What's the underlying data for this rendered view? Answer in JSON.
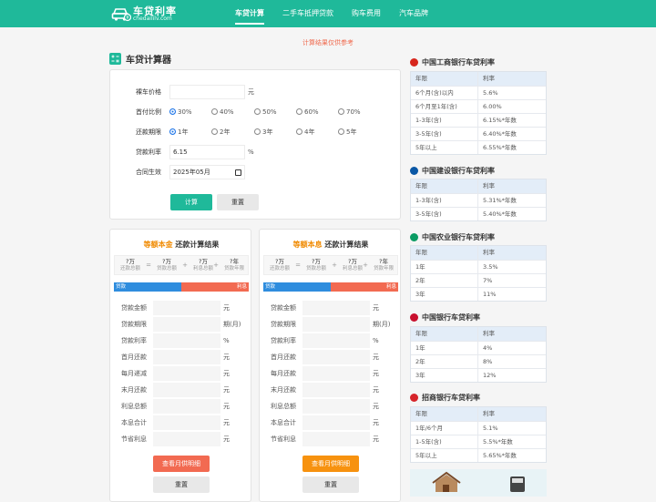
{
  "brand": {
    "title": "车贷利率",
    "subtitle": "chedaililv.com",
    "color": "#1fb99a"
  },
  "nav": [
    {
      "label": "车贷计算",
      "active": true
    },
    {
      "label": "二手车抵押贷款",
      "active": false
    },
    {
      "label": "购车费用",
      "active": false
    },
    {
      "label": "汽车品牌",
      "active": false
    }
  ],
  "notice": "计算结果仅供参考",
  "calculator": {
    "title": "车贷计算器",
    "price": {
      "label": "裸车价格",
      "value": "",
      "unit": "元"
    },
    "down_payment": {
      "label": "首付比例",
      "options": [
        "30%",
        "40%",
        "50%",
        "60%",
        "70%"
      ],
      "selected": "30%"
    },
    "term": {
      "label": "还款期限",
      "options": [
        "1年",
        "2年",
        "3年",
        "4年",
        "5年"
      ],
      "selected": "1年"
    },
    "rate": {
      "label": "贷款利率",
      "value": "6.15",
      "unit": "%"
    },
    "start": {
      "label": "合同生效",
      "value": "2025年05月"
    },
    "calc_button": "计算",
    "reset_button": "重置"
  },
  "results": [
    {
      "title_hl": "等额本金",
      "title_rest": "还款计算结果",
      "formula": [
        {
          "value": "?万",
          "label": "还款总额"
        },
        {
          "value": "?万",
          "label": "贷款总额"
        },
        {
          "value": "?万",
          "label": "利息总额"
        },
        {
          "value": "?年",
          "label": "贷款年限"
        }
      ],
      "ops": [
        "=",
        "+",
        "+"
      ],
      "bar_left": "贷款",
      "bar_right": "利息",
      "rows": [
        {
          "label": "贷款金额",
          "unit": "元"
        },
        {
          "label": "贷款期限",
          "unit": "期(月)"
        },
        {
          "label": "贷款利率",
          "unit": "%"
        },
        {
          "label": "首月还款",
          "unit": "元"
        },
        {
          "label": "每月递减",
          "unit": "元"
        },
        {
          "label": "末月还款",
          "unit": "元"
        },
        {
          "label": "利息总额",
          "unit": "元"
        },
        {
          "label": "本息合计",
          "unit": "元"
        },
        {
          "label": "节省利息",
          "unit": "元"
        }
      ],
      "detail_button": "查看月供明细",
      "detail_color": "#f26a51",
      "reset_button": "重置"
    },
    {
      "title_hl": "等额本息",
      "title_rest": "还款计算结果",
      "formula": [
        {
          "value": "?万",
          "label": "还款总额"
        },
        {
          "value": "?万",
          "label": "贷款总额"
        },
        {
          "value": "?万",
          "label": "利息总额"
        },
        {
          "value": "?年",
          "label": "贷款年限"
        }
      ],
      "ops": [
        "=",
        "+",
        "+"
      ],
      "bar_left": "贷款",
      "bar_right": "利息",
      "rows": [
        {
          "label": "贷款金额",
          "unit": "元"
        },
        {
          "label": "贷款期限",
          "unit": "期(月)"
        },
        {
          "label": "贷款利率",
          "unit": "%"
        },
        {
          "label": "首月还款",
          "unit": "元"
        },
        {
          "label": "每月还款",
          "unit": "元"
        },
        {
          "label": "末月还款",
          "unit": "元"
        },
        {
          "label": "利息总额",
          "unit": "元"
        },
        {
          "label": "本息合计",
          "unit": "元"
        },
        {
          "label": "节省利息",
          "unit": "元"
        }
      ],
      "detail_button": "查看月供明细",
      "detail_color": "#f7920f",
      "reset_button": "重置"
    }
  ],
  "banks": [
    {
      "name": "中国工商银行车贷利率",
      "color": "#d7261c",
      "header": [
        "年限",
        "利率"
      ],
      "rows": [
        [
          "6个月(含)以内",
          "5.6%"
        ],
        [
          "6个月至1年(含)",
          "6.00%"
        ],
        [
          "1-3年(含)",
          "6.15%*年数"
        ],
        [
          "3-5年(含)",
          "6.40%*年数"
        ],
        [
          "5年以上",
          "6.55%*年数"
        ]
      ]
    },
    {
      "name": "中国建设银行车贷利率",
      "color": "#0a57a5",
      "header": [
        "年限",
        "利率"
      ],
      "rows": [
        [
          "1-3年(含)",
          "5.31%*年数"
        ],
        [
          "3-5年(含)",
          "5.40%*年数"
        ]
      ]
    },
    {
      "name": "中国农业银行车贷利率",
      "color": "#0a9b63",
      "header": [
        "年限",
        "利率"
      ],
      "rows": [
        [
          "1年",
          "3.5%"
        ],
        [
          "2年",
          "7%"
        ],
        [
          "3年",
          "11%"
        ]
      ]
    },
    {
      "name": "中国银行车贷利率",
      "color": "#c8102e",
      "header": [
        "年限",
        "利率"
      ],
      "rows": [
        [
          "1年",
          "4%"
        ],
        [
          "2年",
          "8%"
        ],
        [
          "3年",
          "12%"
        ]
      ]
    },
    {
      "name": "招商银行车贷利率",
      "color": "#d6242a",
      "header": [
        "年限",
        "利率"
      ],
      "rows": [
        [
          "1年/6个月",
          "5.1%"
        ],
        [
          "1-5年(含)",
          "5.5%*年数"
        ],
        [
          "5年以上",
          "5.65%*年数"
        ]
      ]
    }
  ]
}
